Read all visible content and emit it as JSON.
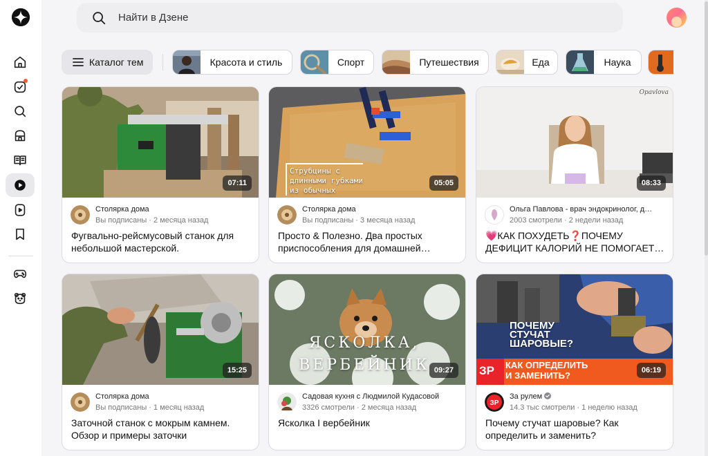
{
  "header": {
    "search_placeholder": "Найти в Дзене"
  },
  "sidebar": {
    "items": [
      {
        "name": "home-icon"
      },
      {
        "name": "subscriptions-icon",
        "has_badge": true
      },
      {
        "name": "search-icon"
      },
      {
        "name": "games-store-icon"
      },
      {
        "name": "articles-icon"
      },
      {
        "name": "video-icon",
        "active": true
      },
      {
        "name": "shorts-icon"
      },
      {
        "name": "bookmark-icon"
      },
      {
        "name": "gamepad-icon"
      },
      {
        "name": "kids-bear-icon"
      }
    ]
  },
  "topics": {
    "catalog_label": "Каталог тем",
    "chips": [
      {
        "label": "Красота и стиль"
      },
      {
        "label": "Спорт"
      },
      {
        "label": "Путешествия"
      },
      {
        "label": "Еда"
      },
      {
        "label": "Наука"
      }
    ]
  },
  "cards": [
    {
      "duration": "07:11",
      "channel": "Столярка дома",
      "meta": "Вы подписаны · 2 месяца назад",
      "title": "Фугвально-рейсмусовый станок для небольшой мастерской."
    },
    {
      "duration": "05:05",
      "channel": "Столярка дома",
      "meta": "Вы подписаны · 3 месяца назад",
      "title": "Просто & Полезно. Два простых приспособления для домашней…",
      "overlay_line1": "Струбцины с",
      "overlay_line2": "длинными губками",
      "overlay_line3": "из обычных"
    },
    {
      "duration": "08:33",
      "channel": "Ольга Павлова - врач эндокринолог, д…",
      "meta": "2003 смотрели · 2 недели назад",
      "title": "💗КАК ПОХУДЕТЬ❓ПОЧЕМУ ДЕФИЦИТ КАЛОРИЙ НЕ ПОМОГАЕТ…",
      "watermark": "Opavlova"
    },
    {
      "duration": "15:25",
      "channel": "Столярка дома",
      "meta": "Вы подписаны · 1 месяц назад",
      "title": "Заточной станок с мокрым камнем. Обзор и примеры заточки"
    },
    {
      "duration": "09:27",
      "channel": "Садовая кухня с Людмилой Кудасовой",
      "meta": "3326 смотрели · 2 месяца назад",
      "title": "Ясколка I вербейник",
      "overlay_line1": "ЯСКОЛКА,",
      "overlay_line2": "ВЕРБЕЙНИК"
    },
    {
      "duration": "06:19",
      "channel": "За рулем",
      "meta": "14.3 тыс смотрели · 1 неделю назад",
      "title": "Почему стучат шаровые? Как определить и заменить?",
      "overlay_line1": "ПОЧЕМУ",
      "overlay_line2": "СТУЧАТ",
      "overlay_line3": "ШАРОВЫЕ?",
      "overlay_line4": "КАК ОПРЕДЕЛИТЬ",
      "overlay_line5": "И ЗАМЕНИТЬ?",
      "badge": "ЗР",
      "verified": true
    }
  ]
}
